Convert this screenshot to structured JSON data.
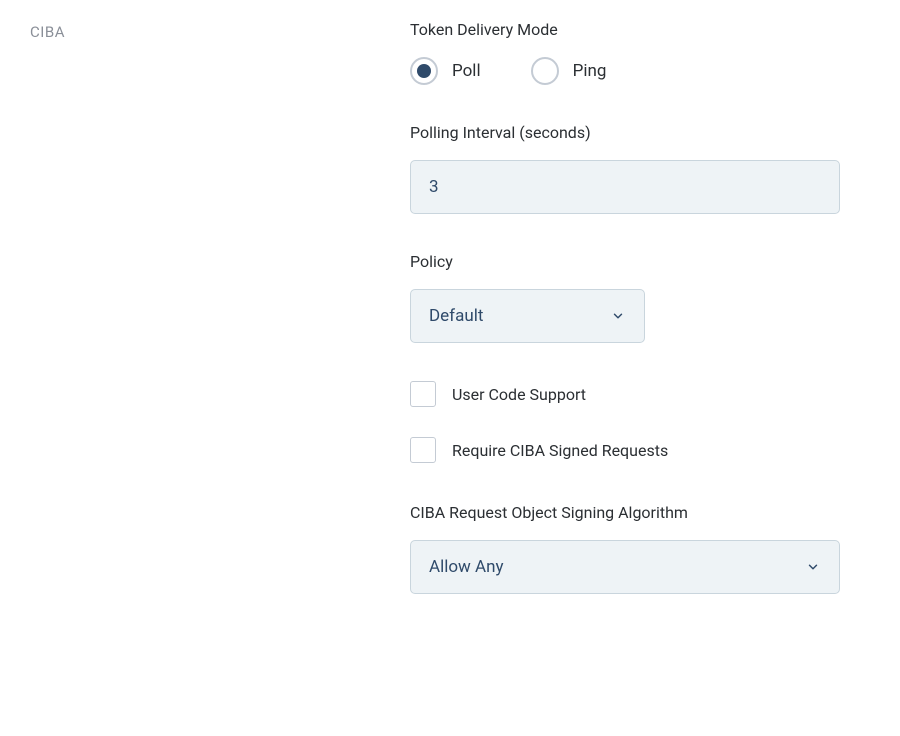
{
  "section": {
    "title": "CIBA"
  },
  "tokenDelivery": {
    "label": "Token Delivery Mode",
    "options": {
      "poll": "Poll",
      "ping": "Ping"
    },
    "selected": "poll"
  },
  "pollingInterval": {
    "label": "Polling Interval (seconds)",
    "value": "3"
  },
  "policy": {
    "label": "Policy",
    "value": "Default"
  },
  "userCodeSupport": {
    "label": "User Code Support",
    "checked": false
  },
  "requireSignedRequests": {
    "label": "Require CIBA Signed Requests",
    "checked": false
  },
  "signingAlgorithm": {
    "label": "CIBA Request Object Signing Algorithm",
    "value": "Allow Any"
  }
}
